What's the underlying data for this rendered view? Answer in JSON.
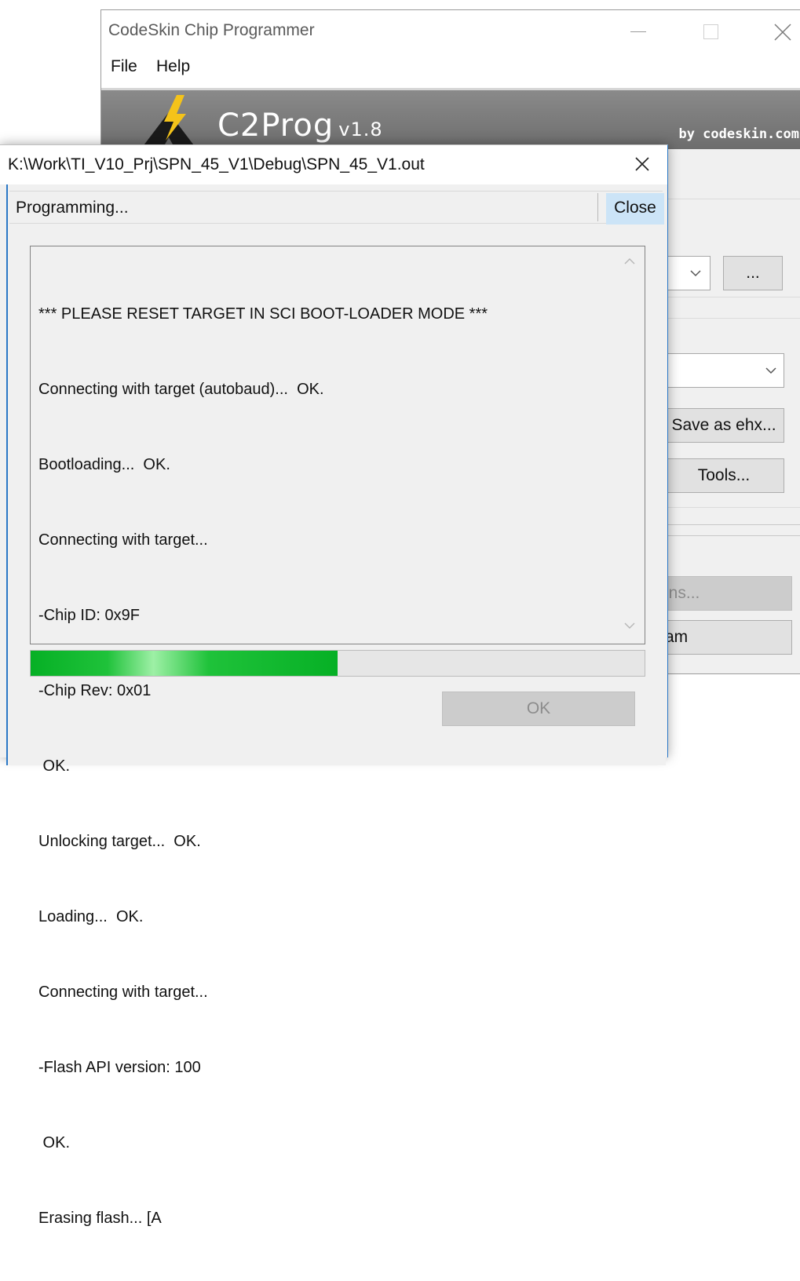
{
  "main_window": {
    "title": "CodeSkin Chip Programmer",
    "menu": [
      "File",
      "Help"
    ],
    "banner": {
      "product": "C2Prog",
      "version": "v1.8",
      "by": "by codeskin.com"
    },
    "buttons": {
      "browse": "...",
      "save_as_ehx": "Save as ehx...",
      "tools": "Tools...",
      "options_partial": "ons...",
      "program_partial": "ram"
    }
  },
  "dialog": {
    "title": "K:\\Work\\TI_V10_Prj\\SPN_45_V1\\Debug\\SPN_45_V1.out",
    "status": "Programming...",
    "close_label": "Close",
    "log": [
      "*** PLEASE RESET TARGET IN SCI BOOT-LOADER MODE ***",
      "Connecting with target (autobaud)...  OK.",
      "Bootloading...  OK.",
      "Connecting with target...",
      "-Chip ID: 0x9F",
      "-Chip Rev: 0x01",
      " OK.",
      "Unlocking target...  OK.",
      "Loading...  OK.",
      "Connecting with target...",
      "-Flash API version: 100",
      " OK.",
      "Erasing flash... [A"
    ],
    "progress_fraction": 0.5,
    "ok_label": "OK"
  },
  "colors": {
    "accent": "#2b78c6",
    "progress_green": "#06b025",
    "close_highlight": "#cce4f7"
  }
}
